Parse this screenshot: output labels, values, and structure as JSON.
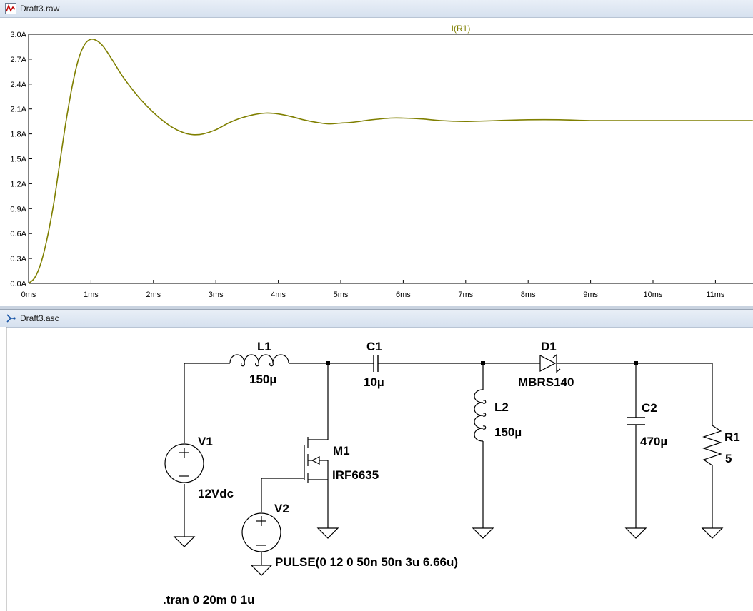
{
  "waveform_window": {
    "title": "Draft3.raw",
    "trace_label": "I(R1)",
    "trace_color": "#7f7f00",
    "y_ticks": [
      "3.0A",
      "2.7A",
      "2.4A",
      "2.1A",
      "1.8A",
      "1.5A",
      "1.2A",
      "0.9A",
      "0.6A",
      "0.3A",
      "0.0A"
    ],
    "x_ticks": [
      "0ms",
      "1ms",
      "2ms",
      "3ms",
      "4ms",
      "5ms",
      "6ms",
      "7ms",
      "8ms",
      "9ms",
      "10ms",
      "11ms"
    ]
  },
  "chart_data": {
    "type": "line",
    "title": "I(R1)",
    "xlabel": "",
    "ylabel": "",
    "x_unit": "ms",
    "y_unit": "A",
    "xlim": [
      0,
      11.6
    ],
    "ylim": [
      0,
      3.0
    ],
    "grid": false,
    "series": [
      {
        "name": "I(R1)",
        "x": [
          0,
          0.1,
          0.2,
          0.3,
          0.4,
          0.5,
          0.6,
          0.7,
          0.8,
          0.9,
          1.0,
          1.1,
          1.2,
          1.35,
          1.5,
          1.7,
          1.9,
          2.1,
          2.3,
          2.5,
          2.65,
          2.8,
          3.0,
          3.2,
          3.4,
          3.6,
          3.8,
          4.0,
          4.2,
          4.4,
          4.6,
          4.8,
          5.0,
          5.2,
          5.5,
          5.8,
          6.0,
          6.3,
          6.6,
          7.0,
          7.5,
          8.0,
          8.5,
          9.0,
          9.5,
          10.0,
          10.5,
          11.0,
          11.6
        ],
        "y": [
          0.0,
          0.07,
          0.25,
          0.55,
          0.95,
          1.45,
          1.95,
          2.38,
          2.7,
          2.88,
          2.94,
          2.92,
          2.85,
          2.68,
          2.5,
          2.3,
          2.13,
          1.99,
          1.88,
          1.81,
          1.79,
          1.8,
          1.85,
          1.93,
          1.99,
          2.03,
          2.05,
          2.04,
          2.01,
          1.97,
          1.94,
          1.92,
          1.93,
          1.94,
          1.97,
          1.99,
          1.99,
          1.98,
          1.96,
          1.95,
          1.96,
          1.97,
          1.97,
          1.96,
          1.96,
          1.96,
          1.96,
          1.96,
          1.96
        ]
      }
    ]
  },
  "schematic_window": {
    "title": "Draft3.asc",
    "components": {
      "L1": {
        "name": "L1",
        "value": "150µ"
      },
      "C1": {
        "name": "C1",
        "value": "10µ"
      },
      "D1": {
        "name": "D1",
        "value": "MBRS140"
      },
      "L2": {
        "name": "L2",
        "value": "150µ"
      },
      "C2": {
        "name": "C2",
        "value": "470µ"
      },
      "R1": {
        "name": "R1",
        "value": "5"
      },
      "V1": {
        "name": "V1",
        "value": "12Vdc"
      },
      "M1": {
        "name": "M1",
        "value": "IRF6635"
      },
      "V2": {
        "name": "V2",
        "value": "PULSE(0 12 0 50n 50n 3u 6.66u)"
      }
    },
    "directive": ".tran 0 20m 0 1u"
  }
}
